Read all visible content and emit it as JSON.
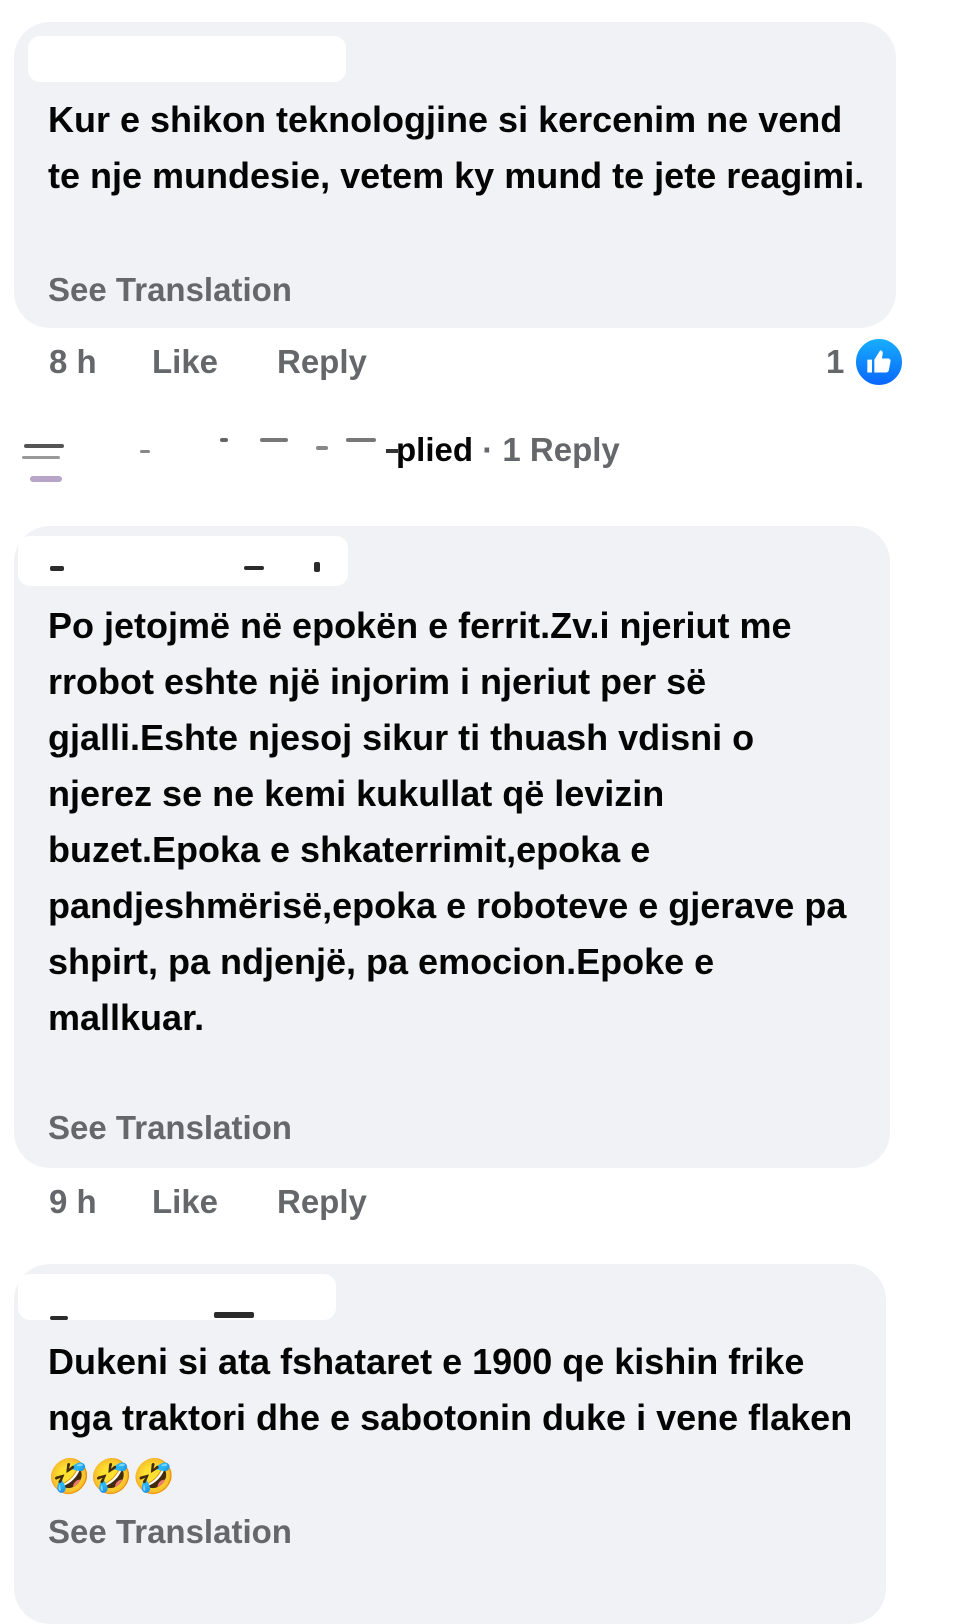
{
  "comments": [
    {
      "text": "Kur e shikon teknologjine si kercenim ne vend te nje mundesie, vetem ky mund te jete reagimi.",
      "see_translation": "See Translation",
      "time": "8 h",
      "like_label": "Like",
      "reply_label": "Reply",
      "reaction_count": "1",
      "reaction_icon": "like-thumb-icon"
    },
    {
      "text": "Po jetojmë në epokën e ferrit.Zv.i njeriut me rrobot eshte një injorim i njeriut per së gjalli.Eshte njesoj sikur ti thuash vdisni o njerez se ne kemi kukullat që levizin buzet.Epoka e shkaterrimit,epoka e pandjeshmërisë,epoka e roboteve e gjerave pa shpirt, pa ndjenjë, pa emocion.Epoke e mallkuar.",
      "see_translation": "See Translation",
      "time": "9 h",
      "like_label": "Like",
      "reply_label": "Reply"
    },
    {
      "text": "Dukeni si ata fshataret e 1900 qe kishin frike nga traktori dhe e sabotonin duke i vene flaken",
      "emoji": "🤣🤣🤣",
      "see_translation": "See Translation"
    }
  ],
  "replies_summary": {
    "replied_text": "plied",
    "separator": "·",
    "count_text": "1 Reply"
  },
  "colors": {
    "bubble": "#f0f2f5",
    "secondary_text": "#65676b",
    "primary_text": "#050505",
    "like_blue": "#0866ff"
  }
}
